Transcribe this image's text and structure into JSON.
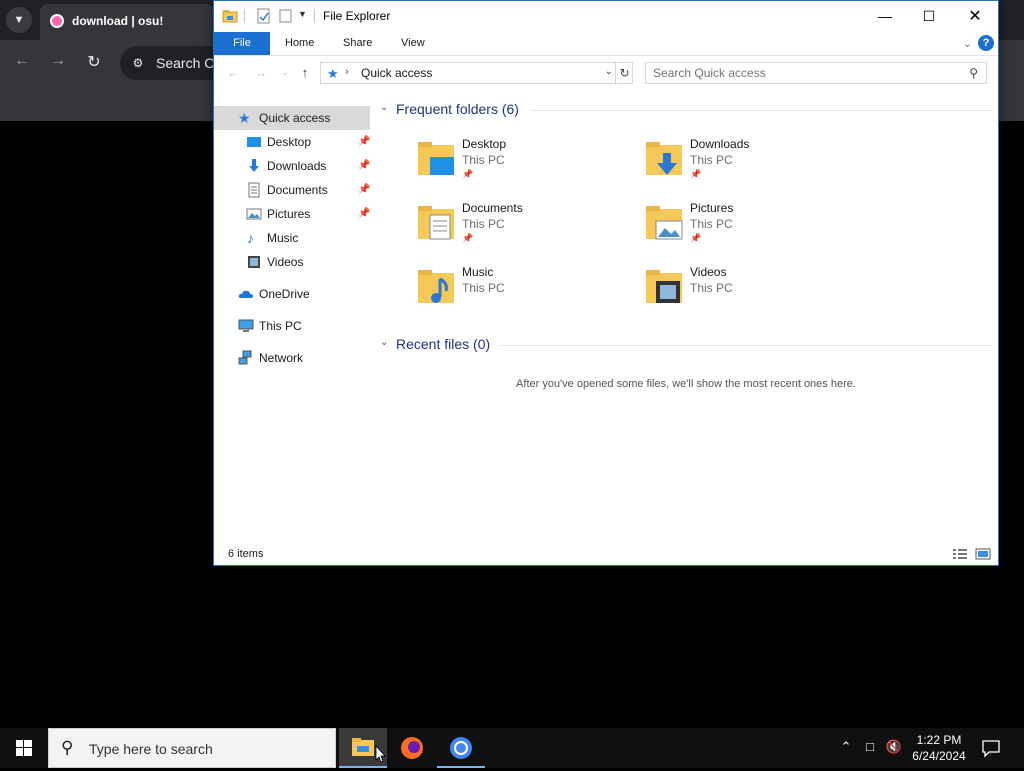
{
  "browser": {
    "tab_title": "download | osu!",
    "omnibox_text": "Search Co"
  },
  "explorer": {
    "title": "File Explorer",
    "ribbon": {
      "file": "File",
      "home": "Home",
      "share": "Share",
      "view": "View",
      "help": "?"
    },
    "address": {
      "location": "Quick access",
      "search_placeholder": "Search Quick access"
    },
    "nav": {
      "quick_access": "Quick access",
      "desktop": "Desktop",
      "downloads": "Downloads",
      "documents": "Documents",
      "pictures": "Pictures",
      "music": "Music",
      "videos": "Videos",
      "onedrive": "OneDrive",
      "this_pc": "This PC",
      "network": "Network"
    },
    "frequent_header": "Frequent folders (6)",
    "folders": [
      {
        "name": "Desktop",
        "location": "This PC"
      },
      {
        "name": "Downloads",
        "location": "This PC"
      },
      {
        "name": "Documents",
        "location": "This PC"
      },
      {
        "name": "Pictures",
        "location": "This PC"
      },
      {
        "name": "Music",
        "location": "This PC"
      },
      {
        "name": "Videos",
        "location": "This PC"
      }
    ],
    "recent_header": "Recent files (0)",
    "recent_empty": "After you've opened some files, we'll show the most recent ones here.",
    "status": "6 items"
  },
  "taskbar": {
    "search_placeholder": "Type here to search",
    "time": "1:22 PM",
    "date": "6/24/2024"
  },
  "colors": {
    "accent": "#1a6fd0",
    "folder": "#f6c858",
    "header_blue": "#1e3287"
  }
}
